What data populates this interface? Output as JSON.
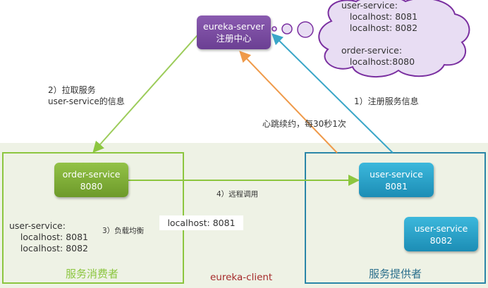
{
  "registry": {
    "title": "eureka-server",
    "subtitle": "注册中心"
  },
  "cloud": {
    "lines": [
      "user-service:",
      "   localhost: 8081",
      "   localhost: 8082",
      "",
      "order-service:",
      "   localhost:8080"
    ]
  },
  "arrows": {
    "pull": "2）拉取服务\nuser-service的信息",
    "register": "1）注册服务信息",
    "heartbeat": "心跳续约，每30秒1次",
    "remote_call": "4）远程调用",
    "load_balance": "3）负载均衡"
  },
  "consumer": {
    "label": "服务消费者",
    "node": {
      "name": "order-service",
      "port": "8080"
    },
    "cache": "user-service:\n    localhost: 8081\n    localhost: 8082"
  },
  "provider": {
    "label": "服务提供者",
    "nodes": [
      {
        "name": "user-service",
        "port": "8081"
      },
      {
        "name": "user-service",
        "port": "8082"
      }
    ]
  },
  "chosen": "localhost: 8081",
  "client_label": "eureka-client",
  "colors": {
    "purple": "#7a4ba3",
    "green": "#8cc63f",
    "blue": "#2a9cc4",
    "orange": "#ef9a4a",
    "red": "#a52a2a"
  }
}
